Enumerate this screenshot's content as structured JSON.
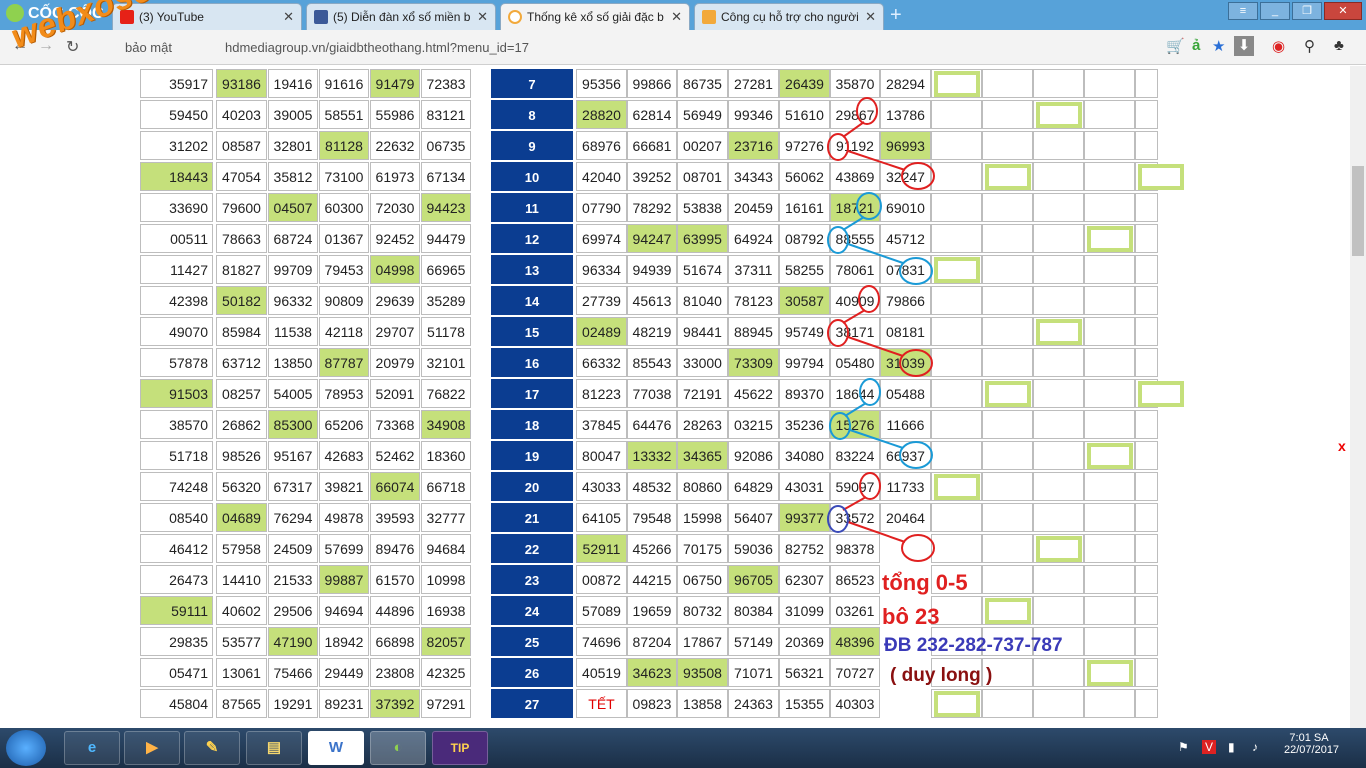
{
  "browser": {
    "brand": "CỐC CỐC",
    "tabs": [
      {
        "label": "(3) YouTube",
        "icon": "youtube-icon"
      },
      {
        "label": "(5) Diễn đàn xổ số miền b",
        "icon": "facebook-icon"
      },
      {
        "label": "Thống kê xổ số giải đặc b",
        "icon": "loading-icon"
      },
      {
        "label": "Công cụ hỗ trợ cho người",
        "icon": "xs-icon"
      }
    ],
    "security_label": "bảo mật",
    "url": "hdmediagroup.vn/giaidbtheothang.html?menu_id=17"
  },
  "watermark": "webxoso.net",
  "left_table": [
    [
      "35917",
      "93186",
      "19416",
      "91616",
      "91479",
      "72383"
    ],
    [
      "59450",
      "40203",
      "39005",
      "58551",
      "55986",
      "83121"
    ],
    [
      "31202",
      "08587",
      "32801",
      "81128",
      "22632",
      "06735"
    ],
    [
      "18443",
      "47054",
      "35812",
      "73100",
      "61973",
      "67134"
    ],
    [
      "33690",
      "79600",
      "04507",
      "60300",
      "72030",
      "94423"
    ],
    [
      "00511",
      "78663",
      "68724",
      "01367",
      "92452",
      "94479"
    ],
    [
      "11427",
      "81827",
      "99709",
      "79453",
      "04998",
      "66965"
    ],
    [
      "42398",
      "50182",
      "96332",
      "90809",
      "29639",
      "35289"
    ],
    [
      "49070",
      "85984",
      "11538",
      "42118",
      "29707",
      "51178"
    ],
    [
      "57878",
      "63712",
      "13850",
      "87787",
      "20979",
      "32101"
    ],
    [
      "91503",
      "08257",
      "54005",
      "78953",
      "52091",
      "76822"
    ],
    [
      "38570",
      "26862",
      "85300",
      "65206",
      "73368",
      "34908"
    ],
    [
      "51718",
      "98526",
      "95167",
      "42683",
      "52462",
      "18360"
    ],
    [
      "74248",
      "56320",
      "67317",
      "39821",
      "66074",
      "66718"
    ],
    [
      "08540",
      "04689",
      "76294",
      "49878",
      "39593",
      "32777"
    ],
    [
      "46412",
      "57958",
      "24509",
      "57699",
      "89476",
      "94684"
    ],
    [
      "26473",
      "14410",
      "21533",
      "99887",
      "61570",
      "10998"
    ],
    [
      "59111",
      "40602",
      "29506",
      "94694",
      "44896",
      "16938"
    ],
    [
      "29835",
      "53577",
      "47190",
      "18942",
      "66898",
      "82057"
    ],
    [
      "05471",
      "13061",
      "75466",
      "29449",
      "23808",
      "42325"
    ],
    [
      "45804",
      "87565",
      "19291",
      "89231",
      "37392",
      "97291"
    ]
  ],
  "right_table": [
    {
      "day": "7",
      "values": [
        "95356",
        "99866",
        "86735",
        "27281",
        "26439",
        "35870",
        "28294"
      ]
    },
    {
      "day": "8",
      "values": [
        "28820",
        "62814",
        "56949",
        "99346",
        "51610",
        "29867",
        "13786"
      ]
    },
    {
      "day": "9",
      "values": [
        "68976",
        "66681",
        "00207",
        "23716",
        "97276",
        "91192",
        "96993"
      ]
    },
    {
      "day": "10",
      "values": [
        "42040",
        "39252",
        "08701",
        "34343",
        "56062",
        "43869",
        "32247"
      ]
    },
    {
      "day": "11",
      "values": [
        "07790",
        "78292",
        "53838",
        "20459",
        "16161",
        "18721",
        "69010"
      ]
    },
    {
      "day": "12",
      "values": [
        "69974",
        "94247",
        "63995",
        "64924",
        "08792",
        "88555",
        "45712"
      ]
    },
    {
      "day": "13",
      "values": [
        "96334",
        "94939",
        "51674",
        "37311",
        "58255",
        "78061",
        "07831"
      ]
    },
    {
      "day": "14",
      "values": [
        "27739",
        "45613",
        "81040",
        "78123",
        "30587",
        "40909",
        "79866"
      ]
    },
    {
      "day": "15",
      "values": [
        "02489",
        "48219",
        "98441",
        "88945",
        "95749",
        "38171",
        "08181"
      ]
    },
    {
      "day": "16",
      "values": [
        "66332",
        "85543",
        "33000",
        "73309",
        "99794",
        "05480",
        "31039"
      ]
    },
    {
      "day": "17",
      "values": [
        "81223",
        "77038",
        "72191",
        "45622",
        "89370",
        "18644",
        "05488"
      ]
    },
    {
      "day": "18",
      "values": [
        "37845",
        "64476",
        "28263",
        "03215",
        "35236",
        "15276",
        "11666"
      ]
    },
    {
      "day": "19",
      "values": [
        "80047",
        "13332",
        "34365",
        "92086",
        "34080",
        "83224",
        "66937"
      ]
    },
    {
      "day": "20",
      "values": [
        "43033",
        "48532",
        "80860",
        "64829",
        "43031",
        "59097",
        "11733"
      ]
    },
    {
      "day": "21",
      "values": [
        "64105",
        "79548",
        "15998",
        "56407",
        "99377",
        "33572",
        "20464"
      ]
    },
    {
      "day": "22",
      "values": [
        "52911",
        "45266",
        "70175",
        "59036",
        "82752",
        "98378",
        ""
      ]
    },
    {
      "day": "23",
      "values": [
        "00872",
        "44215",
        "06750",
        "96705",
        "62307",
        "86523",
        ""
      ]
    },
    {
      "day": "24",
      "values": [
        "57089",
        "19659",
        "80732",
        "80384",
        "31099",
        "03261",
        ""
      ]
    },
    {
      "day": "25",
      "values": [
        "74696",
        "87204",
        "17867",
        "57149",
        "20369",
        "48396",
        ""
      ]
    },
    {
      "day": "26",
      "values": [
        "40519",
        "34623",
        "93508",
        "71071",
        "56321",
        "70727",
        ""
      ]
    },
    {
      "day": "27",
      "values": [
        "TẾT",
        "09823",
        "13858",
        "24363",
        "15355",
        "40303",
        ""
      ]
    }
  ],
  "annotations": {
    "line1": "tổng 0-5",
    "line2": "bô 23",
    "line3": "ĐB 232-282-737-787",
    "line4": "( duy long )"
  },
  "close_label": "x",
  "clock": {
    "time": "7:01 SA",
    "date": "22/07/2017"
  },
  "colors": {
    "highlight": "#c5e07b",
    "day_cell": "#0b3d91",
    "annotation_red": "#e02020",
    "annotation_blue": "#3a3ab8"
  }
}
